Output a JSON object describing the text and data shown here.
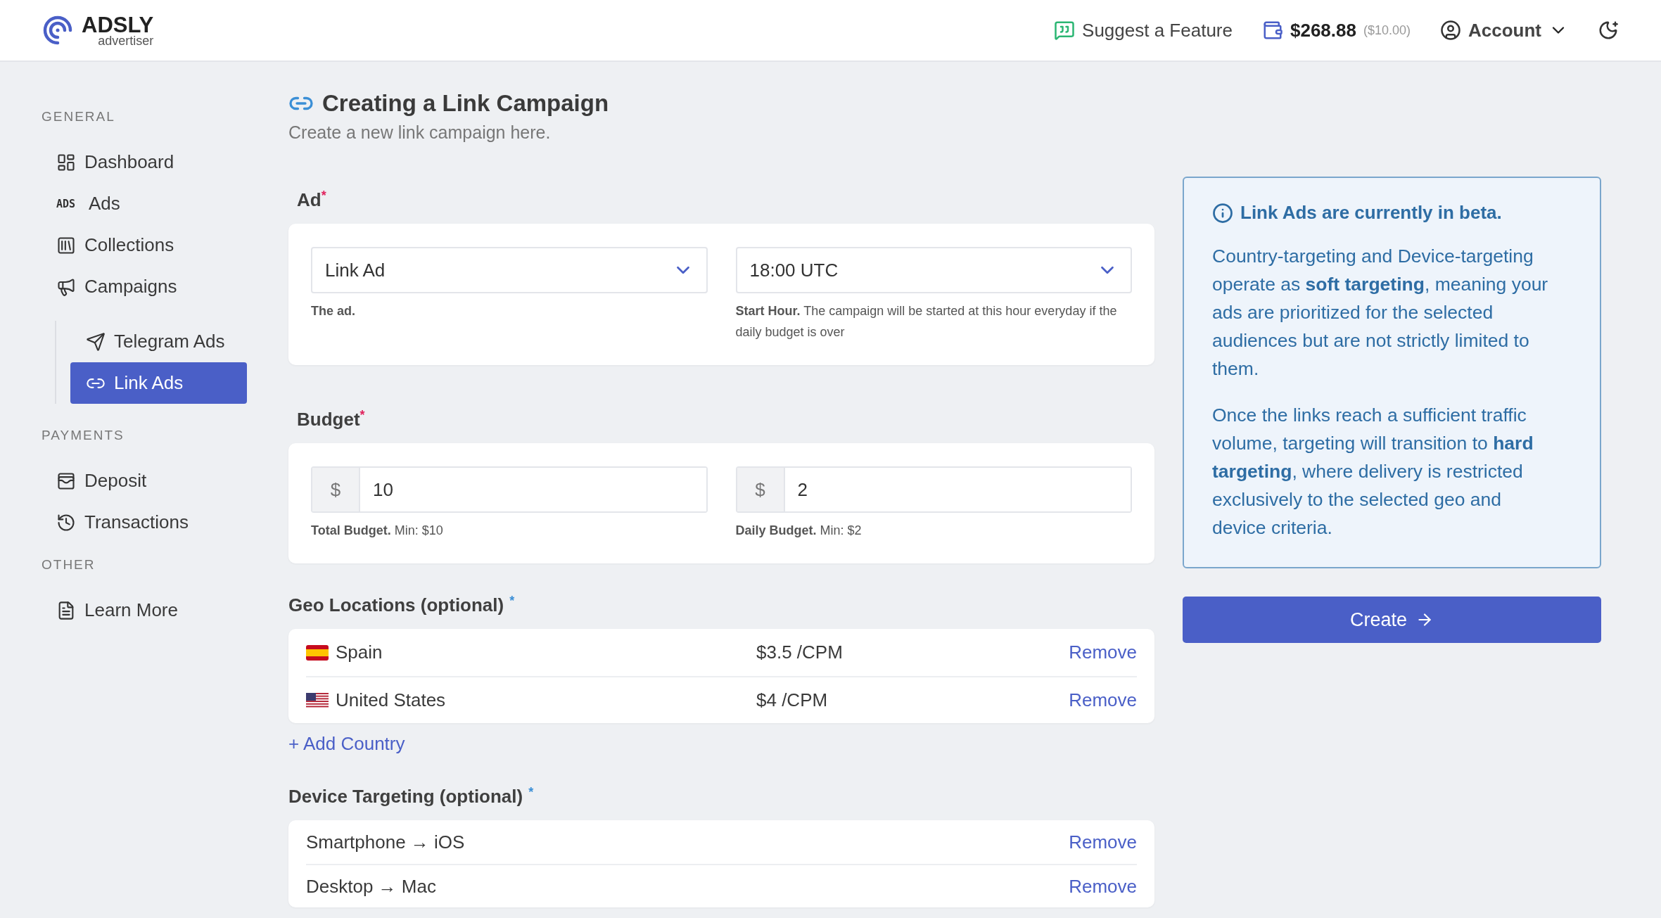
{
  "header": {
    "brand": "ADSLY",
    "brand_sub": "advertiser",
    "suggest": "Suggest a Feature",
    "balance": "$268.88",
    "balance_extra": "($10.00)",
    "account": "Account"
  },
  "sidebar": {
    "sections": [
      {
        "title": "GENERAL",
        "items": [
          {
            "label": "Dashboard",
            "selected": false
          },
          {
            "label": "Ads",
            "icon_text": "ADS",
            "selected": false
          },
          {
            "label": "Collections",
            "selected": false
          },
          {
            "label": "Campaigns",
            "selected": false,
            "children": [
              {
                "label": "Telegram Ads",
                "selected": false
              },
              {
                "label": "Link Ads",
                "selected": true
              }
            ]
          }
        ]
      },
      {
        "title": "PAYMENTS",
        "items": [
          {
            "label": "Deposit",
            "selected": false
          },
          {
            "label": "Transactions",
            "selected": false
          }
        ]
      },
      {
        "title": "OTHER",
        "items": [
          {
            "label": "Learn More",
            "selected": false
          }
        ]
      }
    ]
  },
  "page": {
    "title": "Creating a Link Campaign",
    "subtitle": "Create a new link campaign here."
  },
  "ad_section": {
    "label": "Ad",
    "mark": "*",
    "fields": [
      {
        "kind": "select",
        "value": "Link Ad",
        "help_bold": "The ad."
      },
      {
        "kind": "select",
        "value": "18:00 UTC",
        "help_bold": "Start Hour.",
        "help": "The campaign will be started at this hour everyday if the daily budget is over"
      }
    ]
  },
  "budget_section": {
    "label": "Budget",
    "mark": "*",
    "fields": [
      {
        "kind": "money",
        "prefix": "$",
        "value": "10",
        "help_bold": "Total Budget.",
        "help": "Min: $10"
      },
      {
        "kind": "money",
        "prefix": "$",
        "value": "2",
        "help_bold": "Daily Budget.",
        "help": "Min: $2"
      }
    ]
  },
  "geo": {
    "label": "Geo Locations (optional)",
    "mark": "*",
    "rows": [
      {
        "country": "Spain",
        "price": "$3.5 /CPM",
        "action": "Remove"
      },
      {
        "country": "United States",
        "price": "$4 /CPM",
        "action": "Remove"
      }
    ],
    "add": "+ Add Country"
  },
  "devices": {
    "label": "Device Targeting (optional)",
    "mark": "*",
    "rows": [
      {
        "device": "Smartphone → iOS",
        "action": "Remove"
      },
      {
        "device": "Desktop → Mac",
        "action": "Remove"
      }
    ]
  },
  "info": {
    "title": "Link Ads are currently in beta.",
    "paragraphs": [
      "Country-targeting and Device-targeting operate as **soft targeting**, meaning your ads are prioritized for the selected audiences but are not strictly limited to them.",
      "Once the links reach a sufficient traffic volume, targeting will transition to **hard targeting**, where delivery is restricted exclusively to the selected geo and device criteria."
    ]
  },
  "create_button": "Create"
}
